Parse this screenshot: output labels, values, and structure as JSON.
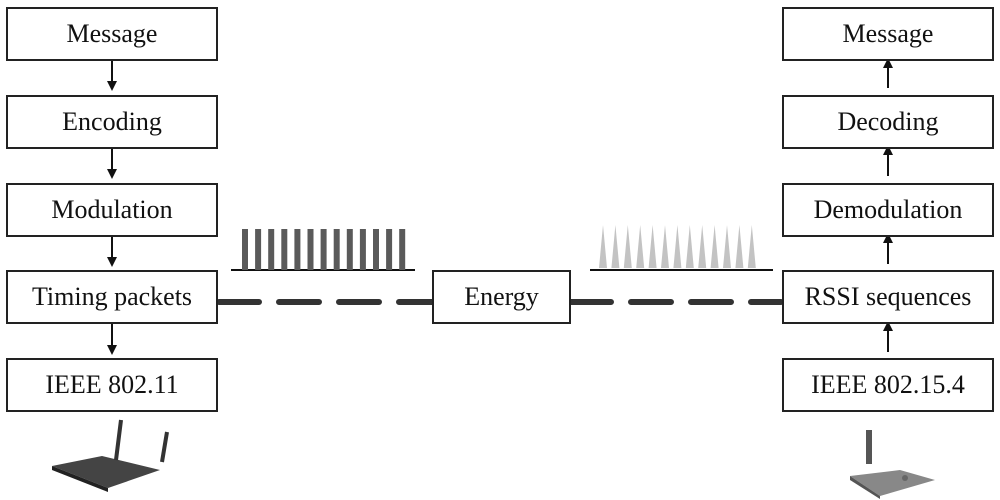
{
  "transmitter": {
    "blocks": [
      "Message",
      "Encoding",
      "Modulation",
      "Timing packets",
      "IEEE 802.11"
    ],
    "device": "wifi-router-icon"
  },
  "channel": {
    "label": "Energy",
    "tx_signal_bars": 13,
    "rx_signal_spikes": 13
  },
  "receiver": {
    "blocks": [
      "Message",
      "Decoding",
      "Demodulation",
      "RSSI sequences",
      "IEEE 802.15.4"
    ],
    "device": "zigbee-node-icon"
  }
}
